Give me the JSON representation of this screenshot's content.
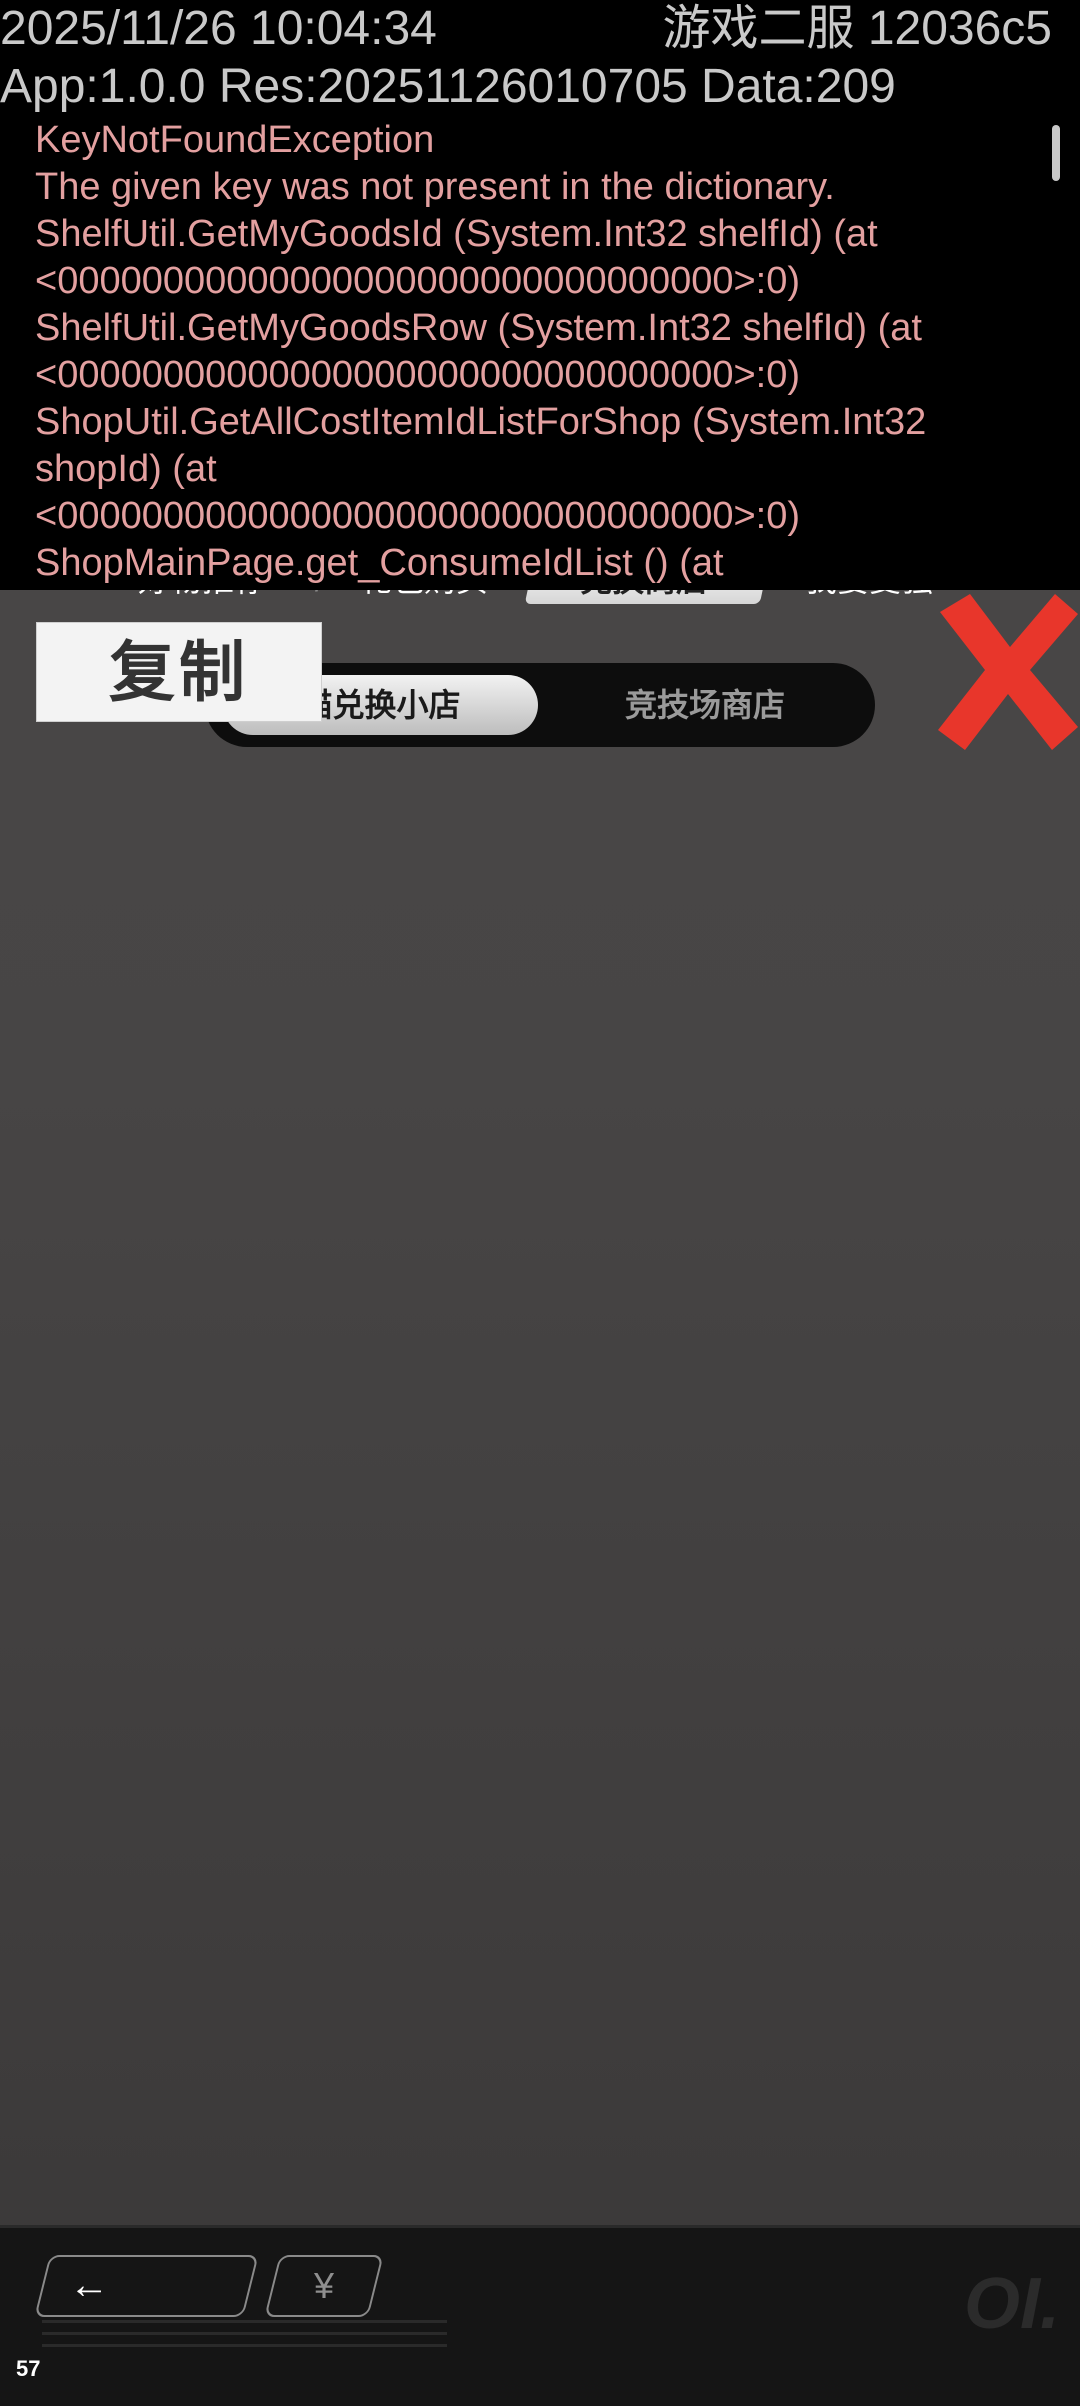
{
  "debug": {
    "timestamp": "2025/11/26 10:04:34",
    "server": "游戏二服 12036c5",
    "version_line": "App:1.0.0 Res:20251126010705 Data:209",
    "log_lines": [
      "KeyNotFoundException",
      "The given key was not present in the dictionary.",
      "ShelfUtil.GetMyGoodsId (System.Int32 shelfId) (at",
      "<00000000000000000000000000000000>:0)",
      "ShelfUtil.GetMyGoodsRow (System.Int32 shelfId) (at",
      "<00000000000000000000000000000000>:0)",
      "ShopUtil.GetAllCostItemIdListForShop (System.Int32",
      "shopId) (at",
      "<00000000000000000000000000000000>:0)",
      "ShopMainPage.get_ConsumeIdList () (at"
    ]
  },
  "top_tabs": [
    "好物推荐",
    "礼包购买",
    "兑换商店",
    "我要变强"
  ],
  "sub_tabs": [
    "猫兑换小店",
    "竞技场商店"
  ],
  "copy_button": "复制",
  "bottom": {
    "back_icon": "←",
    "currency_icon": "¥",
    "watermark": "OI.",
    "fps": "57"
  },
  "colors": {
    "log_text": "#e3a0a0",
    "close_x": "#e8362b",
    "background": "#484646"
  }
}
